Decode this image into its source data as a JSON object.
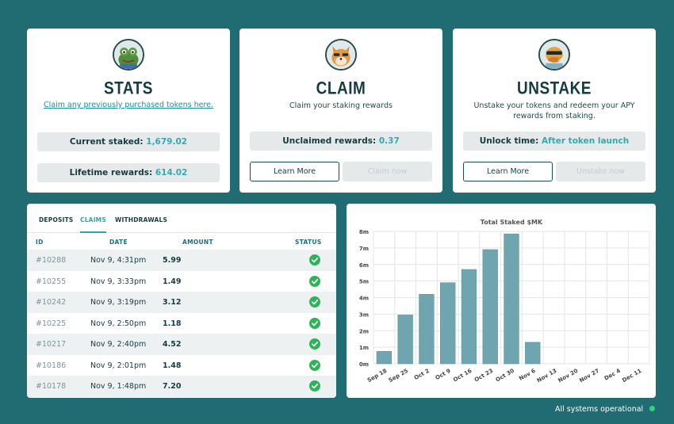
{
  "cards": {
    "stats": {
      "title": "STATS",
      "link": "Claim any previously purchased tokens here.",
      "current_staked_label": "Current staked:",
      "current_staked_value": "1,679.02",
      "lifetime_rewards_label": "Lifetime rewards:",
      "lifetime_rewards_value": "614.02"
    },
    "claim": {
      "title": "CLAIM",
      "desc": "Claim your staking rewards",
      "unclaimed_label": "Unclaimed rewards:",
      "unclaimed_value": "0.37",
      "learn_more": "Learn More",
      "action": "Claim now"
    },
    "unstake": {
      "title": "UNSTAKE",
      "desc": "Unstake your tokens and redeem your APY rewards from staking.",
      "unlock_label": "Unlock time:",
      "unlock_value": "After token launch",
      "learn_more": "Learn More",
      "action": "Unstake now"
    }
  },
  "table": {
    "tabs": [
      "DEPOSITS",
      "CLAIMS",
      "WITHDRAWALS"
    ],
    "active_tab": "CLAIMS",
    "headers": [
      "ID",
      "DATE",
      "AMOUNT",
      "STATUS"
    ],
    "rows": [
      {
        "id": "#10288",
        "date": "Nov 9, 4:31pm",
        "amount": "5.99"
      },
      {
        "id": "#10255",
        "date": "Nov 9, 3:33pm",
        "amount": "1.49"
      },
      {
        "id": "#10242",
        "date": "Nov 9, 3:19pm",
        "amount": "3.12"
      },
      {
        "id": "#10225",
        "date": "Nov 9, 2:50pm",
        "amount": "1.18"
      },
      {
        "id": "#10217",
        "date": "Nov 9, 2:40pm",
        "amount": "4.52"
      },
      {
        "id": "#10186",
        "date": "Nov 9, 2:01pm",
        "amount": "1.48"
      },
      {
        "id": "#10178",
        "date": "Nov 9, 1:48pm",
        "amount": "7.20"
      }
    ]
  },
  "chart_data": {
    "type": "bar",
    "title": "Total Staked $MK",
    "categories": [
      "Sep 18",
      "Sep 25",
      "Oct 2",
      "Oct 9",
      "Oct 16",
      "Oct 23",
      "Oct 30",
      "Nov 6",
      "Nov 13",
      "Nov 20",
      "Nov 27",
      "Dec 4",
      "Dec 11"
    ],
    "values": [
      0.75,
      2.95,
      4.2,
      4.9,
      5.7,
      6.9,
      7.85,
      1.3,
      0,
      0,
      0,
      0,
      0
    ],
    "value_unit": "millions",
    "y_ticks": [
      "0m",
      "1m",
      "2m",
      "3m",
      "4m",
      "5m",
      "6m",
      "7m",
      "8m"
    ],
    "ylim": [
      0,
      8
    ],
    "grid": true,
    "bar_color": "#6fa5ae"
  },
  "footer": {
    "status_text": "All systems operational",
    "status_color": "#2fd37a"
  },
  "colors": {
    "background": "#216b72",
    "accent": "#35a9b0",
    "success": "#2fb35a"
  },
  "icons": {
    "stats_avatar": "frog-avatar-icon",
    "claim_avatar": "shiba-dog-avatar-icon",
    "unstake_avatar": "duck-with-sunglasses-avatar-icon",
    "status": "check-circle-icon"
  }
}
